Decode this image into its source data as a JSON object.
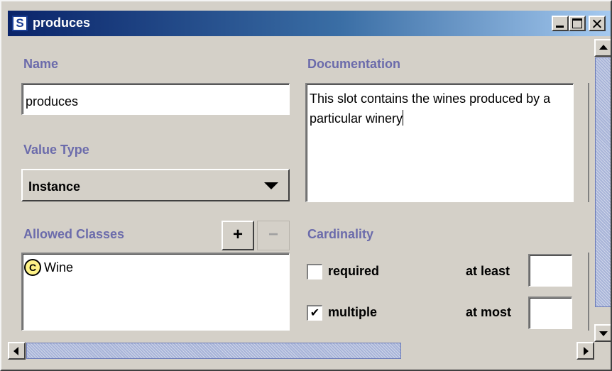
{
  "window": {
    "icon_letter": "S",
    "title": "produces"
  },
  "name": {
    "label": "Name",
    "value": "produces"
  },
  "documentation": {
    "label": "Documentation",
    "value": "This slot contains the wines produced by a particular winery"
  },
  "value_type": {
    "label": "Value Type",
    "selected": "Instance"
  },
  "allowed_classes": {
    "label": "Allowed Classes",
    "add_symbol": "+",
    "remove_symbol": "−",
    "items": [
      {
        "badge": "C",
        "name": "Wine"
      }
    ]
  },
  "cardinality": {
    "label": "Cardinality",
    "required": {
      "label": "required",
      "checked": false,
      "mark": ""
    },
    "multiple": {
      "label": "multiple",
      "checked": true,
      "mark": "✔"
    },
    "at_least": {
      "label": "at least",
      "value": ""
    },
    "at_most": {
      "label": "at most",
      "value": ""
    }
  },
  "colors": {
    "label": "#6b6bab",
    "title_gradient_start": "#0a246a",
    "title_gradient_end": "#a6caf0",
    "panel": "#d4d0c8",
    "scroll_thumb": "#a8b4d8",
    "class_badge": "#fef287"
  },
  "scrollbars": {
    "vertical_scroll_fraction": 0.0,
    "horizontal_scroll_fraction": 0.0
  }
}
